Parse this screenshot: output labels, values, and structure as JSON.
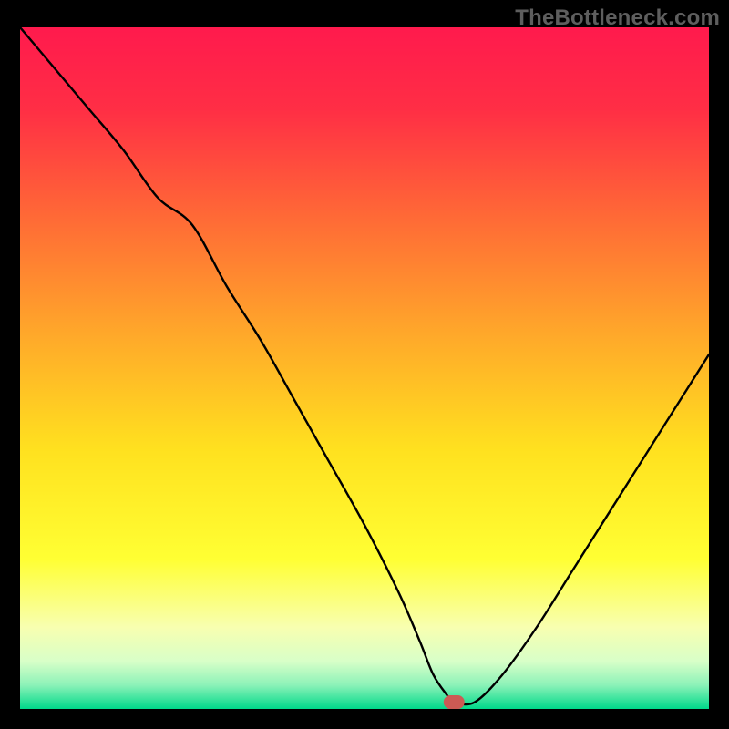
{
  "watermark": "TheBottleneck.com",
  "colors": {
    "gradient_stops": [
      {
        "offset": 0.0,
        "color": "#ff1a4d"
      },
      {
        "offset": 0.12,
        "color": "#ff2e45"
      },
      {
        "offset": 0.28,
        "color": "#ff6a36"
      },
      {
        "offset": 0.45,
        "color": "#ffa82a"
      },
      {
        "offset": 0.62,
        "color": "#ffe11f"
      },
      {
        "offset": 0.78,
        "color": "#ffff33"
      },
      {
        "offset": 0.88,
        "color": "#f8ffb0"
      },
      {
        "offset": 0.93,
        "color": "#d8ffc8"
      },
      {
        "offset": 0.965,
        "color": "#8cf2b8"
      },
      {
        "offset": 1.0,
        "color": "#00d98a"
      }
    ],
    "curve": "#000000",
    "marker": "#cc5a54",
    "frame": "#000000"
  },
  "chart_data": {
    "type": "line",
    "title": "",
    "xlabel": "",
    "ylabel": "",
    "xlim": [
      0,
      100
    ],
    "ylim": [
      0,
      100
    ],
    "marker": {
      "x": 63,
      "y": 1
    },
    "series": [
      {
        "name": "bottleneck-curve",
        "x": [
          0,
          5,
          10,
          15,
          20,
          25,
          30,
          35,
          40,
          45,
          50,
          55,
          58,
          60,
          62,
          63,
          66,
          70,
          75,
          80,
          85,
          90,
          95,
          100
        ],
        "y": [
          100,
          94,
          88,
          82,
          75,
          71,
          62,
          54,
          45,
          36,
          27,
          17,
          10,
          5,
          2,
          1,
          1,
          5,
          12,
          20,
          28,
          36,
          44,
          52
        ]
      }
    ]
  }
}
